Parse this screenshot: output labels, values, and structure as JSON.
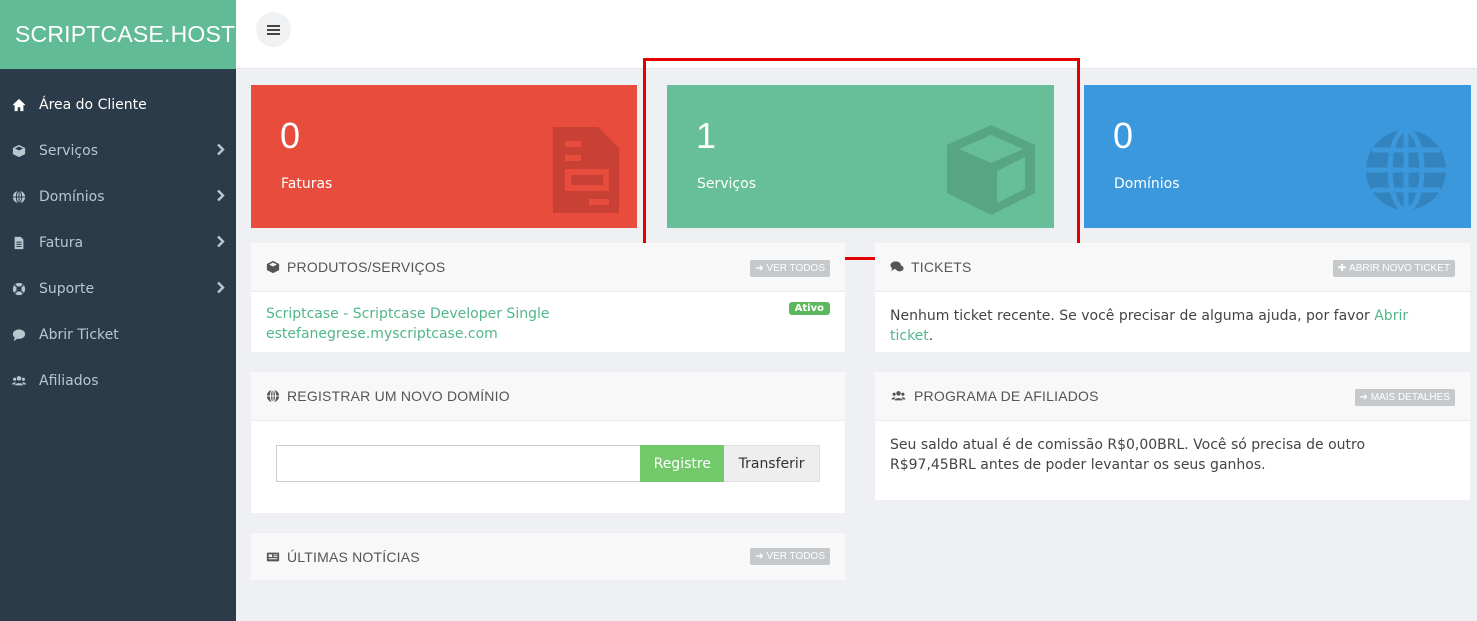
{
  "brand": "SCRIPTCASE.HOST",
  "sidebar": {
    "items": [
      {
        "label": "Área do Cliente",
        "icon": "home-icon",
        "active": true,
        "submenu": false
      },
      {
        "label": "Serviços",
        "icon": "cube-icon",
        "active": false,
        "submenu": true
      },
      {
        "label": "Domínios",
        "icon": "globe-icon",
        "active": false,
        "submenu": true
      },
      {
        "label": "Fatura",
        "icon": "file-icon",
        "active": false,
        "submenu": true
      },
      {
        "label": "Suporte",
        "icon": "life-ring-icon",
        "active": false,
        "submenu": true
      },
      {
        "label": "Abrir Ticket",
        "icon": "comment-icon",
        "active": false,
        "submenu": false
      },
      {
        "label": "Afiliados",
        "icon": "users-icon",
        "active": false,
        "submenu": false
      }
    ]
  },
  "stats": {
    "faturas": {
      "count": "0",
      "label": "Faturas",
      "color": "#e74c3c"
    },
    "servicos": {
      "count": "1",
      "label": "Serviços",
      "color": "#66bf98"
    },
    "dominios": {
      "count": "0",
      "label": "Domínios",
      "color": "#3b98dc"
    }
  },
  "products": {
    "title": "PRODUTOS/SERVIÇOS",
    "view_all": "VER TODOS",
    "item_name": "Scriptcase - Scriptcase Developer Single",
    "item_domain": "estefanegrese.myscriptcase.com",
    "status": "Ativo"
  },
  "tickets": {
    "title": "TICKETS",
    "new_ticket": "ABRIR NOVO TICKET",
    "message": "Nenhum ticket recente. Se você precisar de alguma ajuda, por favor ",
    "link": "Abrir ticket",
    "suffix": "."
  },
  "domain_register": {
    "title": "REGISTRAR UM NOVO DOMÍNIO",
    "input_value": "",
    "register": "Registre",
    "transfer": "Transferir"
  },
  "affiliates": {
    "title": "PROGRAMA DE AFILIADOS",
    "details": "MAIS DETALHES",
    "text": "Seu saldo atual é de comissão R$0,00BRL. Você só precisa de outro R$97,45BRL antes de poder levantar os seus ganhos."
  },
  "news": {
    "title": "ÚLTIMAS NOTÍCIAS",
    "view_all": "VER TODOS"
  },
  "colors": {
    "sidebar": "#2c3b4a",
    "brand": "#62bb97",
    "highlight": "#e30000"
  }
}
